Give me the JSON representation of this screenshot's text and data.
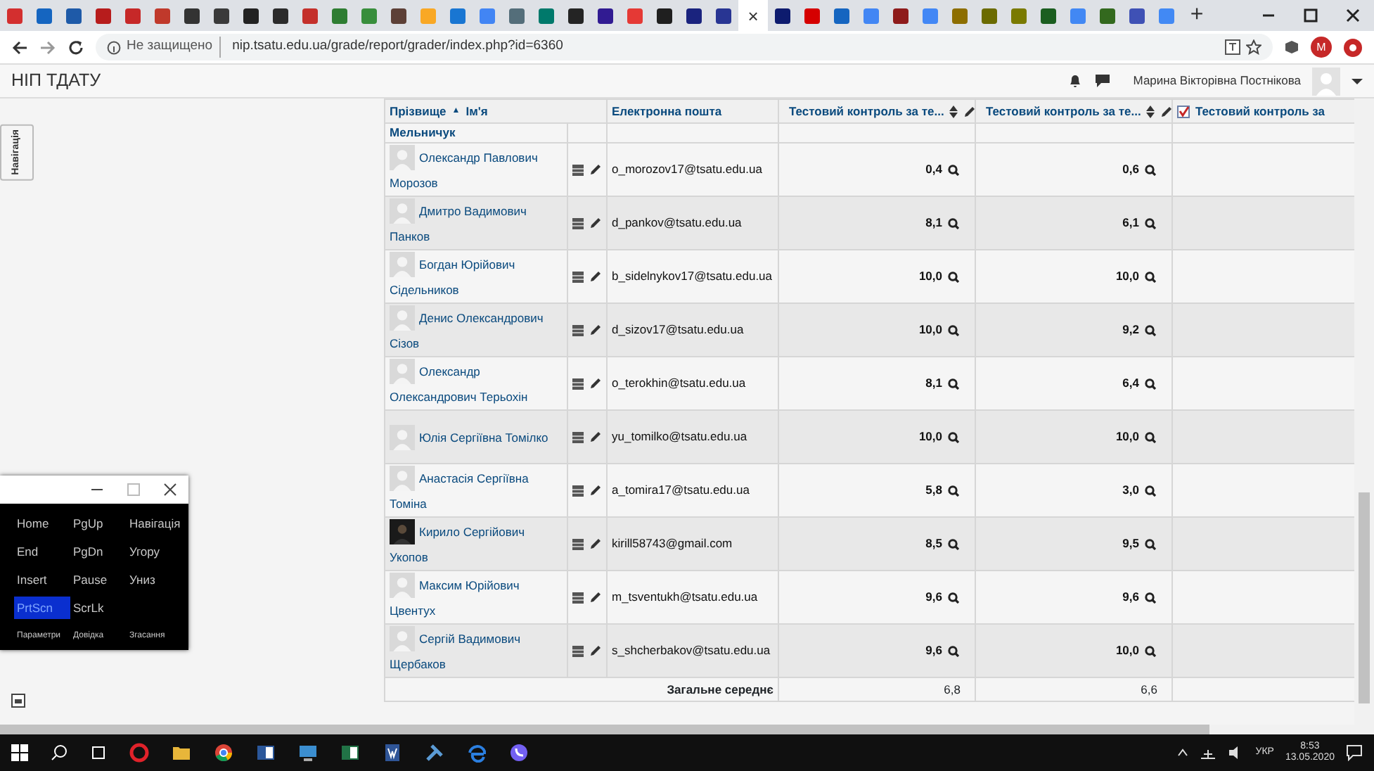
{
  "browser": {
    "tabs": [
      {
        "color": "#d32f2f",
        "selected": false
      },
      {
        "color": "#1565c0",
        "selected": false
      },
      {
        "color": "#1e5aa8",
        "selected": false
      },
      {
        "color": "#b71c1c",
        "selected": false
      },
      {
        "color": "#c62828",
        "selected": false
      },
      {
        "color": "#c0392b",
        "selected": false
      },
      {
        "color": "#333333",
        "selected": false
      },
      {
        "color": "#3a3a3a",
        "selected": false
      },
      {
        "color": "#222222",
        "selected": false
      },
      {
        "color": "#2b2b2b",
        "selected": false
      },
      {
        "color": "#c4302b",
        "selected": false
      },
      {
        "color": "#2e7d32",
        "selected": false
      },
      {
        "color": "#388e3c",
        "selected": false
      },
      {
        "color": "#5d4037",
        "selected": false
      },
      {
        "color": "#f9a825",
        "selected": false
      },
      {
        "color": "#1976d2",
        "selected": false
      },
      {
        "color": "#4285f4",
        "selected": false
      },
      {
        "color": "#546e7a",
        "selected": false
      },
      {
        "color": "#00796b",
        "selected": false
      },
      {
        "color": "#242424",
        "selected": false
      },
      {
        "color": "#311b92",
        "selected": false
      },
      {
        "color": "#e53935",
        "selected": false
      },
      {
        "color": "#1f1f1f",
        "selected": false
      },
      {
        "color": "#1a237e",
        "selected": false
      },
      {
        "color": "#283593",
        "selected": false
      },
      {
        "selected": true,
        "close": "×"
      },
      {
        "color": "#0d1b6e",
        "selected": false
      },
      {
        "color": "#d50000",
        "selected": false
      },
      {
        "color": "#1565c0",
        "selected": false
      },
      {
        "color": "#4286f4",
        "selected": false
      },
      {
        "color": "#8e1b1b",
        "selected": false
      },
      {
        "color": "#4287f5",
        "selected": false
      },
      {
        "color": "#8d6e00",
        "selected": false
      },
      {
        "color": "#6b6b00",
        "selected": false
      },
      {
        "color": "#7a7a00",
        "selected": false
      },
      {
        "color": "#1b5e20",
        "selected": false
      },
      {
        "color": "#4288f4",
        "selected": false
      },
      {
        "color": "#33691e",
        "selected": false
      },
      {
        "color": "#3f51b5",
        "selected": false
      },
      {
        "color": "#4289f4",
        "selected": false
      }
    ],
    "new_tab": "+",
    "security": "Не защищено",
    "url": "nip.tsatu.edu.ua/grade/report/grader/index.php?id=6360",
    "profile_initial": "M"
  },
  "header": {
    "site_name": "НІП ТДАТУ",
    "user_name": "Марина Вікторівна Постнікова"
  },
  "nav_drawer": {
    "label": "Навігація"
  },
  "table": {
    "columns": [
      {
        "kind": "name",
        "surname": "Прізвище",
        "sort_arrow": "▲",
        "first_name": "Ім'я"
      },
      {
        "kind": "email",
        "label": "Електронна пошта"
      },
      {
        "kind": "grade",
        "label": "Тестовий контроль за те..."
      },
      {
        "kind": "grade",
        "label": "Тестовий контроль за те..."
      },
      {
        "kind": "grade",
        "label": "Тестовий контроль за"
      }
    ],
    "partial_row": {
      "name": "Мельничук"
    },
    "rows": [
      {
        "name": "Олександр Павлович Морозов",
        "kind": "default",
        "email": "o_morozov17@tsatu.edu.ua",
        "grades": [
          "0,4",
          "0,6"
        ]
      },
      {
        "name": "Дмитро Вадимович Панков",
        "kind": "default",
        "email": "d_pankov@tsatu.edu.ua",
        "grades": [
          "8,1",
          "6,1"
        ]
      },
      {
        "name": "Богдан Юрійович Сідельников",
        "kind": "default",
        "email": "b_sidelnykov17@tsatu.edu.ua",
        "grades": [
          "10,0",
          "10,0"
        ]
      },
      {
        "name": "Денис Олександрович Сізов",
        "kind": "default",
        "email": "d_sizov17@tsatu.edu.ua",
        "grades": [
          "10,0",
          "9,2"
        ]
      },
      {
        "name": "Олександр Олександрович Терьохін",
        "kind": "default",
        "email": "o_terokhin@tsatu.edu.ua",
        "grades": [
          "8,1",
          "6,4"
        ]
      },
      {
        "name": "Юлія Сергіївна Томілко",
        "kind": "default",
        "email": "yu_tomilko@tsatu.edu.ua",
        "grades": [
          "10,0",
          "10,0"
        ]
      },
      {
        "name": "Анастасія Сергіївна Томіна",
        "kind": "default",
        "email": "a_tomira17@tsatu.edu.ua",
        "grades": [
          "5,8",
          "3,0"
        ]
      },
      {
        "name": "Кирило Сергійович Укопов",
        "kind": "photo",
        "email": "kirill58743@gmail.com",
        "grades": [
          "8,5",
          "9,5"
        ]
      },
      {
        "name": "Максим Юрійович Цвентух",
        "kind": "default",
        "email": "m_tsventukh@tsatu.edu.ua",
        "grades": [
          "9,6",
          "9,6"
        ]
      },
      {
        "name": "Сергій Вадимович Щербаков",
        "kind": "default",
        "email": "s_shcherbakov@tsatu.edu.ua",
        "grades": [
          "9,6",
          "10,0"
        ]
      }
    ],
    "footer": {
      "label": "Загальне середнє",
      "values": [
        "6,8",
        "6,6"
      ]
    }
  },
  "keyboard": {
    "keys": [
      {
        "label": "Home",
        "selected": false
      },
      {
        "label": "PgUp",
        "selected": false
      },
      {
        "label": "Навігація",
        "selected": false
      },
      {
        "label": "End",
        "selected": false
      },
      {
        "label": "PgDn",
        "selected": false
      },
      {
        "label": "Угору",
        "selected": false
      },
      {
        "label": "Insert",
        "selected": false
      },
      {
        "label": "Pause",
        "selected": false
      },
      {
        "label": "Униз",
        "selected": false
      },
      {
        "label": "PrtScn",
        "selected": true
      },
      {
        "label": "ScrLk",
        "selected": false
      },
      {
        "label": "Параметри",
        "selected": false,
        "kind": "small"
      },
      {
        "label": "Довідка",
        "selected": false,
        "kind": "small"
      },
      {
        "label": "Згасання",
        "selected": false,
        "kind": "small"
      }
    ]
  },
  "taskbar": {
    "language": "УКР",
    "time": "8:53",
    "date": "13.05.2020"
  }
}
